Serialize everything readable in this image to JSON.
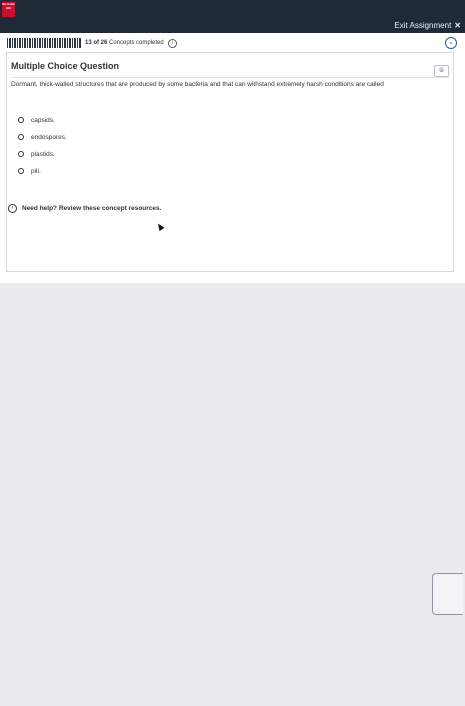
{
  "header": {
    "logo_text": "Mc Graw Hill",
    "exit_label": "Exit Assignment",
    "exit_icon": "close-icon"
  },
  "progress": {
    "count": "13 of 26",
    "label": "Concepts completed",
    "info_icon": "info-icon",
    "collapse_icon": "chevron-down-icon"
  },
  "question": {
    "type_title": "Multiple Choice Question",
    "reader_icon": "reader-icon",
    "text": "Dormant, thick-walled structures that are produced by some bacteria and that can withstand extremely harsh conditions are called",
    "options": [
      "capsids.",
      "endospores.",
      "plastids.",
      "pili."
    ]
  },
  "help": {
    "label": "Need help? Review these concept resources.",
    "icon": "chevron-icon"
  }
}
